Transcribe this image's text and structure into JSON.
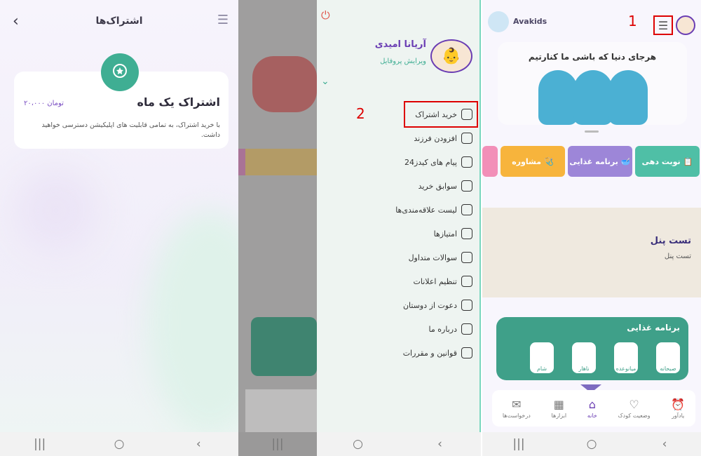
{
  "panel1": {
    "title": "اشتراک‌ها",
    "back_icon": "chevron-left-icon",
    "menu_icon": "menu-icon",
    "badge_icon": "award-icon",
    "plan_name": "اشتراک یک ماه",
    "price": "۲۰،۰۰۰ تومان",
    "description": "با خرید اشتراک، به تمامی قابلیت های اپلیکیشن دسترسی خواهید داشت."
  },
  "drawer": {
    "user_name": "آریانا امیدی",
    "edit_profile": "ویرایش پروفایل",
    "highlight_number": "2",
    "items": [
      {
        "label": "خرید اشتراک",
        "icon": "camera-icon"
      },
      {
        "label": "افزودن فرزند",
        "icon": "add-child-icon"
      },
      {
        "label": "پیام های کیدز24",
        "icon": "message-icon"
      },
      {
        "label": "سوابق خرید",
        "icon": "purchase-history-icon"
      },
      {
        "label": "لیست علاقه‌مندی‌ها",
        "icon": "heart-icon"
      },
      {
        "label": "امتیازها",
        "icon": "trophy-icon"
      },
      {
        "label": "سوالات متداول",
        "icon": "faq-icon"
      },
      {
        "label": "تنظیم اعلانات",
        "icon": "gear-icon"
      },
      {
        "label": "دعوت از دوستان",
        "icon": "invite-icon"
      },
      {
        "label": "درباره ما",
        "icon": "people-icon"
      },
      {
        "label": "قوانین و مقررات",
        "icon": "document-icon"
      }
    ]
  },
  "panel3": {
    "app_name": "Avakids",
    "highlight_number": "1",
    "banner_text": "هرجای دنیا که باشی ما کنارتیم",
    "quick_actions": [
      {
        "label": "نوبت دهی",
        "color": "#4fbfa6"
      },
      {
        "label": "برنامه غذایی",
        "color": "#9d86d8"
      },
      {
        "label": "مشاوره",
        "color": "#f7b43c"
      }
    ],
    "ad_title": "تست پنل",
    "ad_sub": "تست پنل",
    "diet_title": "برنامه غذایی",
    "meals": [
      "صبحانه",
      "میانوعده",
      "ناهار",
      "شام"
    ],
    "tabs": [
      "یادآور",
      "وضعیت کودک",
      "خانه",
      "ابزارها",
      "درخواست‌ها"
    ],
    "active_tab": "خانه"
  },
  "system_nav": [
    "|||",
    "○",
    "‹"
  ]
}
